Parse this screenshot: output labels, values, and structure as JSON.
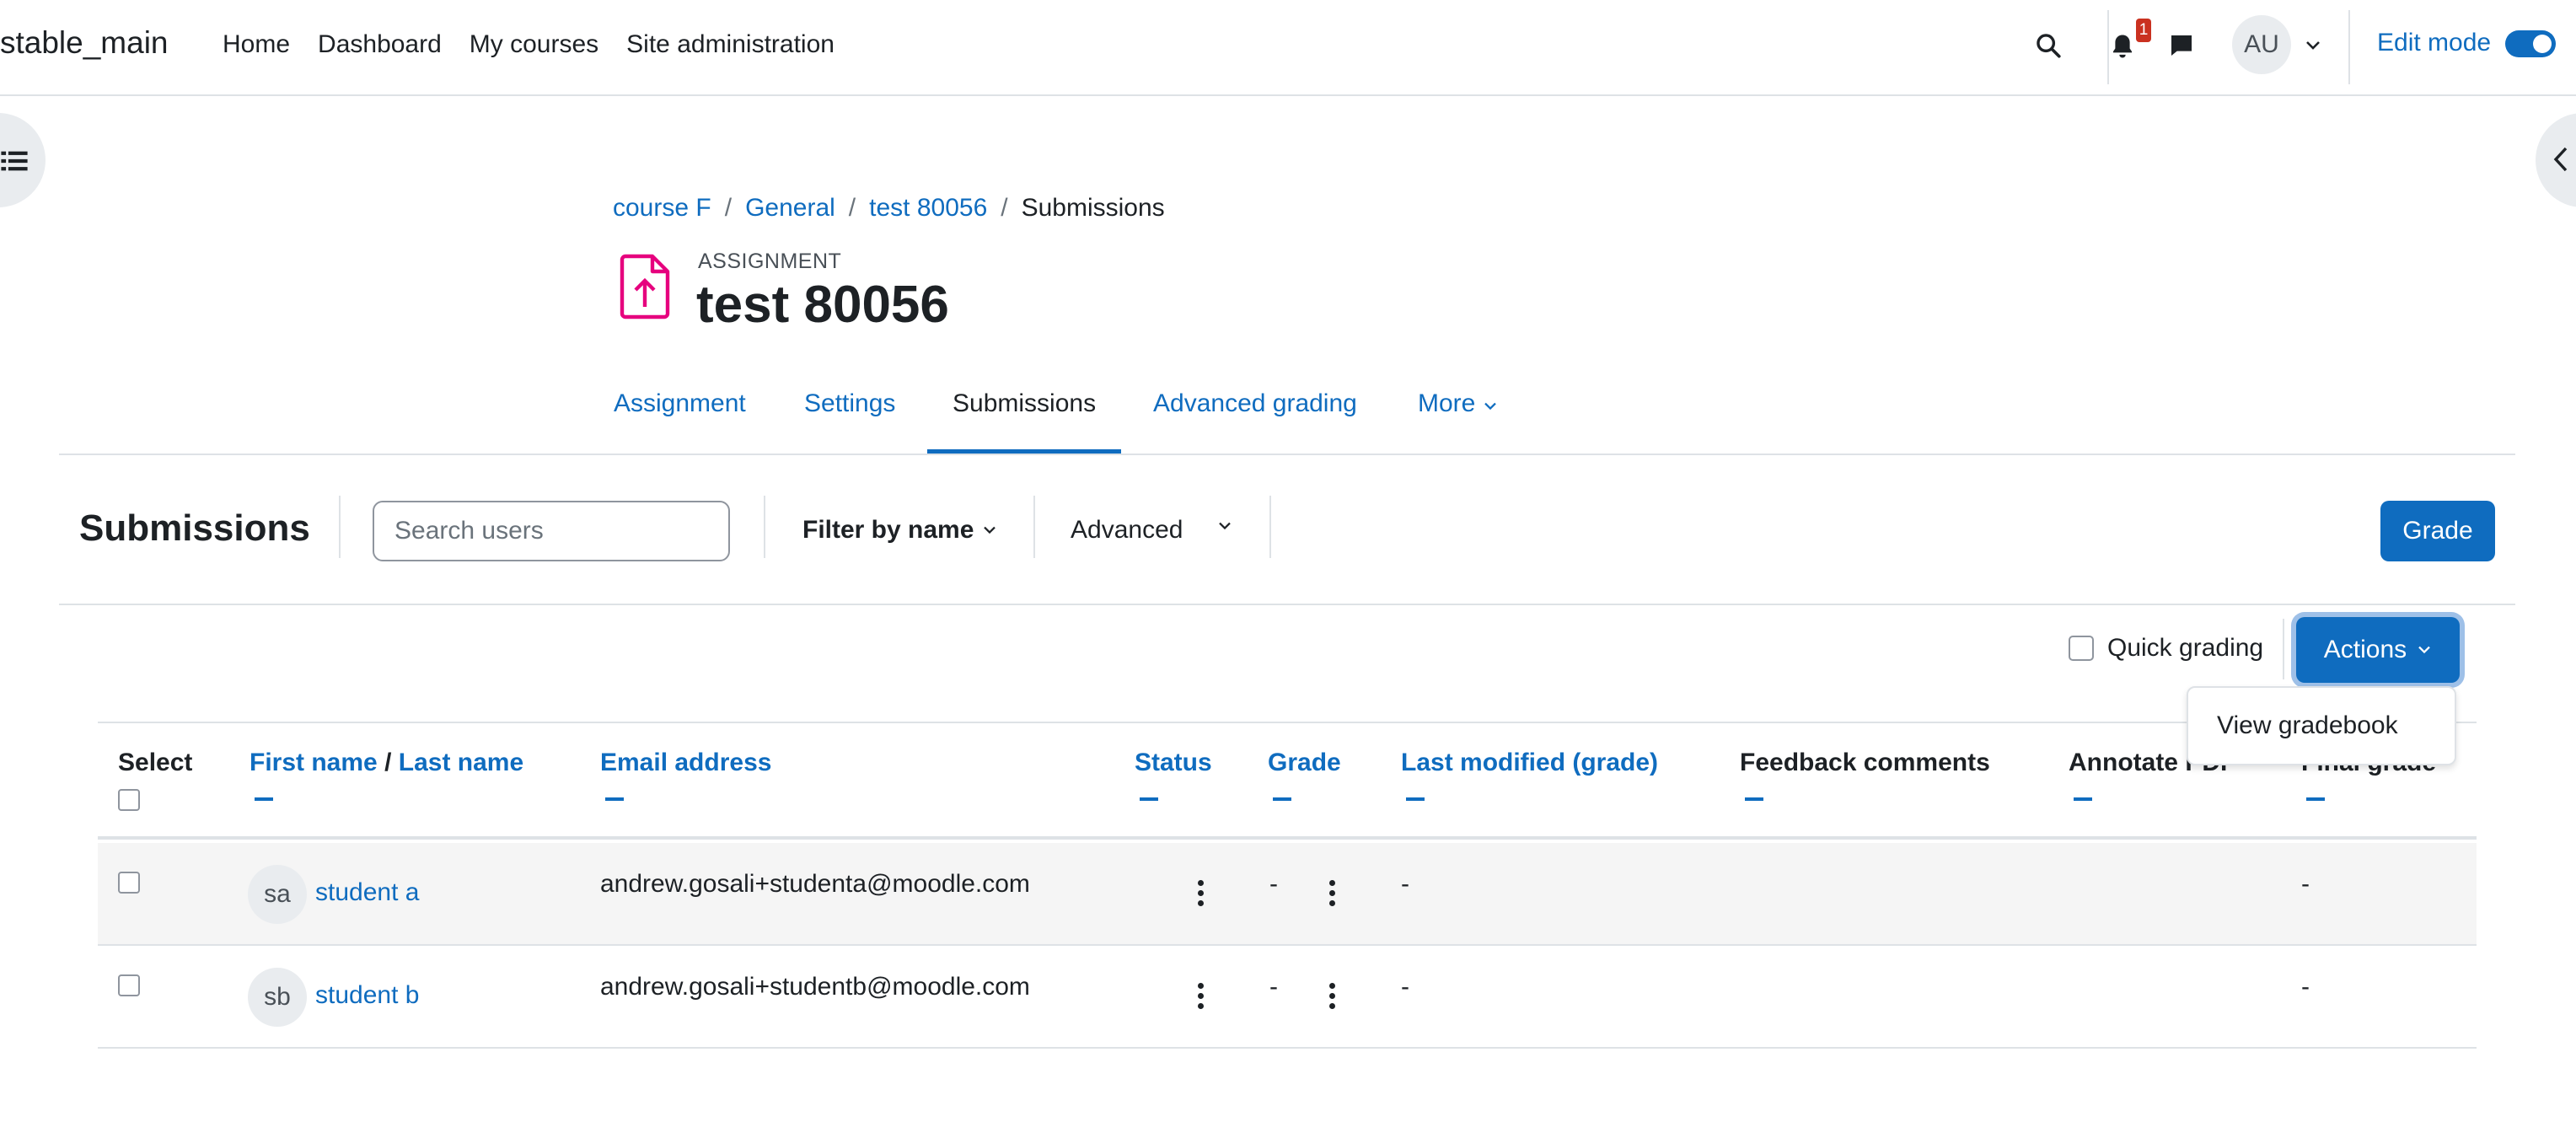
{
  "navbar": {
    "site_name": "stable_main",
    "links": [
      "Home",
      "Dashboard",
      "My courses",
      "Site administration"
    ],
    "notification_count": "1",
    "user_initials": "AU",
    "edit_mode_label": "Edit mode",
    "edit_mode_on": true
  },
  "breadcrumb": {
    "items": [
      "course F",
      "General",
      "test 80056"
    ],
    "current": "Submissions"
  },
  "header": {
    "module_type": "ASSIGNMENT",
    "title": "test 80056"
  },
  "secondary_nav": {
    "tabs": [
      "Assignment",
      "Settings",
      "Submissions",
      "Advanced grading",
      "More"
    ],
    "active": "Submissions"
  },
  "action_bar": {
    "title": "Submissions",
    "search_placeholder": "Search users",
    "filter_by_name": "Filter by name",
    "advanced": "Advanced",
    "grade_button": "Grade"
  },
  "grading": {
    "quick_grading_label": "Quick grading",
    "actions_button": "Actions",
    "dropdown_item": "View gradebook"
  },
  "table": {
    "headers": {
      "select": "Select",
      "first_name": "First name",
      "name_sep": "/",
      "last_name": "Last name",
      "email": "Email address",
      "status": "Status",
      "grade": "Grade",
      "last_modified": "Last modified (grade)",
      "feedback": "Feedback comments",
      "annotate": "Annotate PDF",
      "final_grade": "Final grade"
    },
    "rows": [
      {
        "initials": "sa",
        "name": "student a",
        "email": "andrew.gosali+studenta@moodle.com",
        "grade": "-",
        "last_modified": "-",
        "final_grade": "-"
      },
      {
        "initials": "sb",
        "name": "student b",
        "email": "andrew.gosali+studentb@moodle.com",
        "grade": "-",
        "last_modified": "-",
        "final_grade": "-"
      }
    ]
  },
  "colors": {
    "brand_blue": "#0f6cbf",
    "assignment_icon": "#e6007e",
    "badge_red": "#ca3120"
  }
}
